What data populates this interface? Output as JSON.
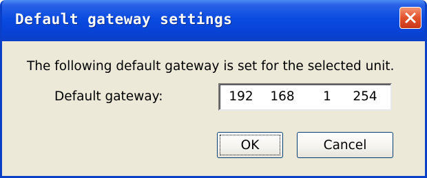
{
  "window": {
    "title": "Default gateway settings",
    "close_icon": "close-icon",
    "accent_color": "#0a4be0",
    "close_color": "#e2522c"
  },
  "dialog": {
    "message": "The following default gateway is set for the selected unit.",
    "gateway_label": "Default gateway:",
    "gateway_octets": [
      "192",
      "168",
      "1",
      "254"
    ]
  },
  "buttons": {
    "ok_label": "OK",
    "cancel_label": "Cancel"
  }
}
